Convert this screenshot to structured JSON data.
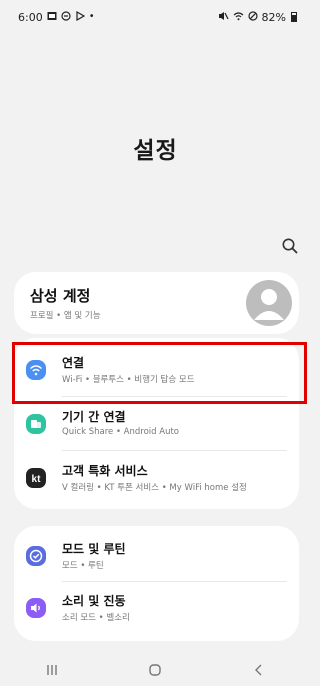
{
  "status": {
    "time": "6:00",
    "battery": "82%"
  },
  "header": {
    "title": "설정"
  },
  "account": {
    "title": "삼성 계정",
    "subtitle": "프로필 • 앱 및 기능"
  },
  "group1": [
    {
      "id": "connections",
      "title": "연결",
      "subtitle": "Wi-Fi • 블루투스 • 비행기 탑승 모드",
      "icon": "wifi-icon",
      "color": "#4a8ff2"
    },
    {
      "id": "device-connect",
      "title": "기기 간 연결",
      "subtitle": "Quick Share • Android Auto",
      "icon": "device-connect-icon",
      "color": "#2ec4a0"
    },
    {
      "id": "kt-service",
      "title": "고객 특화 서비스",
      "subtitle": "V 컬러링 • KT 투폰 서비스 • My WiFi home 설정",
      "icon": "kt-icon",
      "color": "#222222"
    }
  ],
  "group2": [
    {
      "id": "modes",
      "title": "모드 및 루틴",
      "subtitle": "모드 • 루틴",
      "icon": "modes-icon",
      "color": "#5a6de0"
    },
    {
      "id": "sound",
      "title": "소리 및 진동",
      "subtitle": "소리 모드 • 벨소리",
      "icon": "sound-icon",
      "color": "#8b5cf6"
    }
  ],
  "colors": {
    "highlight": "#e00000",
    "background": "#f2f2f2"
  }
}
